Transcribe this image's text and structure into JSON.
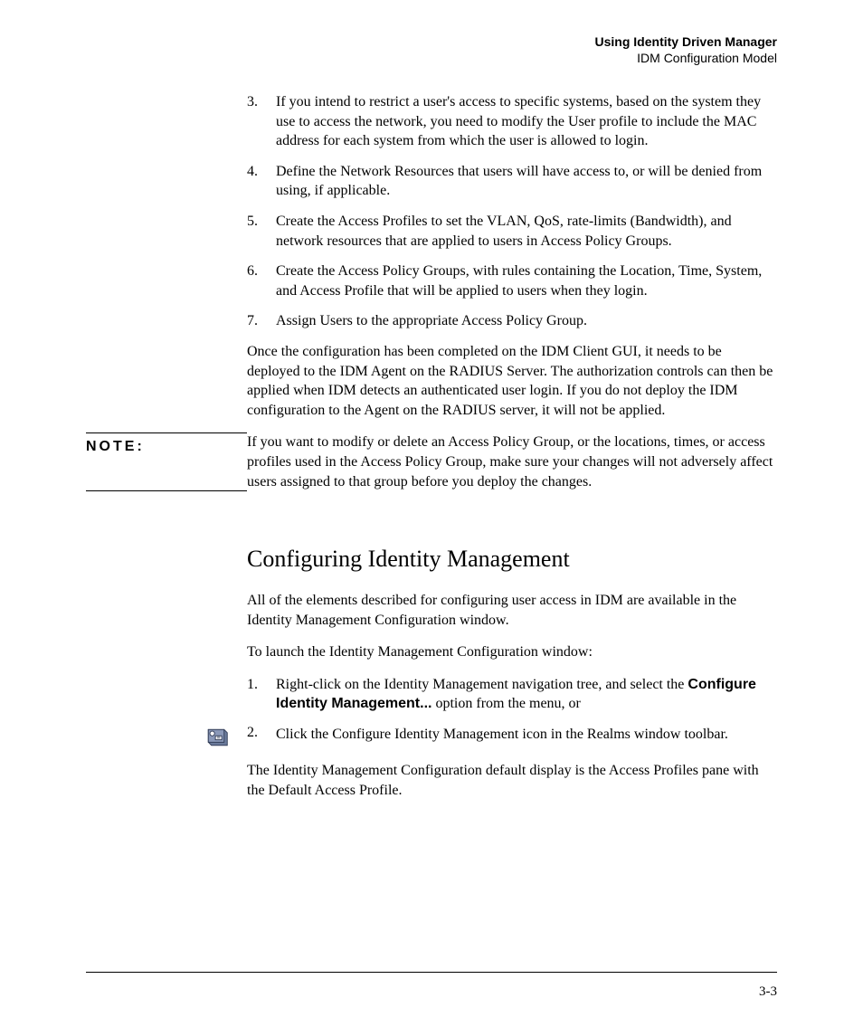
{
  "header": {
    "title": "Using Identity Driven Manager",
    "subtitle": "IDM Configuration Model"
  },
  "list1": [
    {
      "n": "3.",
      "t": "If you intend to restrict a user's access to specific systems, based on the system they use to access the network, you need to modify the User profile to include the MAC address for each system from which the user is allowed to login."
    },
    {
      "n": "4.",
      "t": "Define the Network Resources that users will have access to, or will be denied from using, if applicable."
    },
    {
      "n": "5.",
      "t": "Create the Access Profiles to set the VLAN, QoS, rate-limits (Bandwidth), and network resources that are applied to users in Access Policy Groups."
    },
    {
      "n": "6.",
      "t": "Create the Access Policy Groups, with rules containing the Location, Time, System, and Access Profile that will be applied to users when they login."
    },
    {
      "n": "7.",
      "t": "Assign Users to the appropriate Access Policy Group."
    }
  ],
  "para1": "Once the configuration has been completed on the IDM Client GUI, it needs to be deployed to the IDM Agent on the RADIUS Server. The authorization controls can then be applied when IDM detects an authenticated user login. If you do not deploy the IDM configuration to the Agent on the RADIUS server, it will not be applied.",
  "note": {
    "label": "NOTE:",
    "text": "If you want to modify or delete an Access Policy Group, or the locations, times, or access profiles used in the Access Policy Group, make sure your changes will not adversely affect users assigned to that group before you deploy the changes."
  },
  "section_heading": "Configuring Identity Management",
  "para2": "All of the elements described for configuring user access in IDM are available in the Identity Management Configuration window.",
  "para3": "To launch the Identity Management Configuration window:",
  "list2_item1": {
    "n": "1.",
    "pre": "Right-click on the Identity Management navigation tree, and select the ",
    "bold": "Configure Identity Management...",
    "post": " option from the menu, or"
  },
  "list2_item2": {
    "n": "2.",
    "t": "Click the Configure Identity Management icon in the Realms window toolbar."
  },
  "para4": "The Identity Management Configuration default display is the Access Profiles pane with the Default Access Profile.",
  "page_number": "3-3"
}
